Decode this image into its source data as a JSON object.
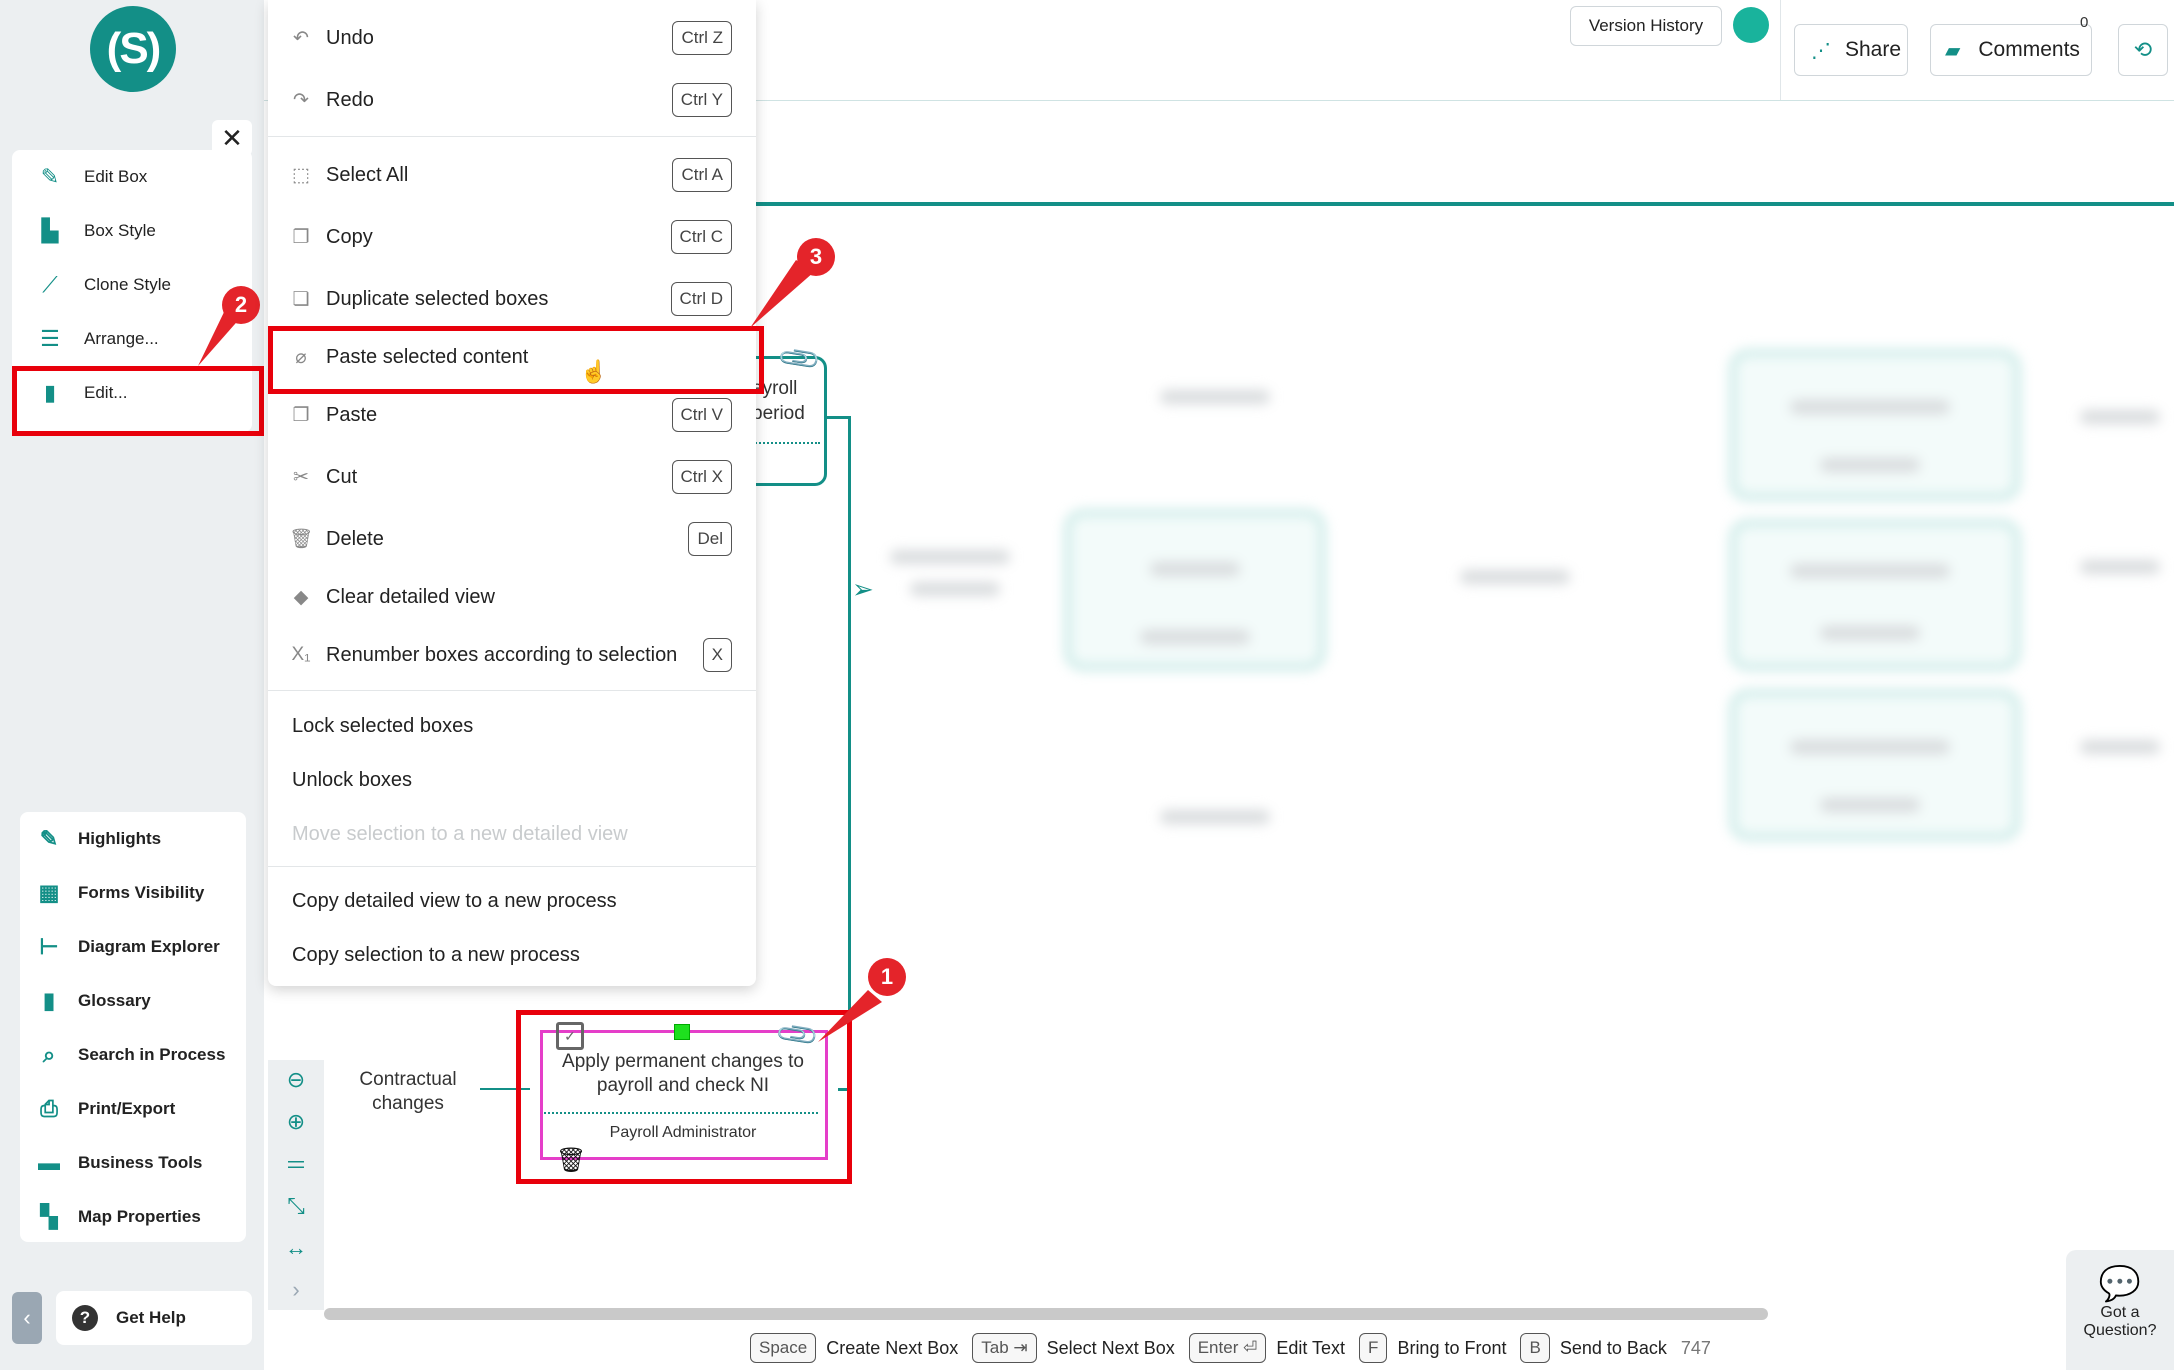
{
  "logo": {
    "text": "(S)"
  },
  "edit_panel": {
    "items": [
      {
        "label": "Edit Box",
        "icon": "pencil-icon"
      },
      {
        "label": "Box Style",
        "icon": "palette-icon"
      },
      {
        "label": "Clone Style",
        "icon": "eyedropper-icon"
      },
      {
        "label": "Arrange...",
        "icon": "align-icon"
      },
      {
        "label": "Edit...",
        "icon": "clipboard-icon"
      }
    ]
  },
  "tools_panel": {
    "items": [
      {
        "label": "Highlights",
        "icon": "highlighter-icon"
      },
      {
        "label": "Forms Visibility",
        "icon": "table-icon"
      },
      {
        "label": "Diagram Explorer",
        "icon": "tree-icon"
      },
      {
        "label": "Glossary",
        "icon": "book-icon"
      },
      {
        "label": "Search in Process",
        "icon": "search-icon"
      },
      {
        "label": "Print/Export",
        "icon": "printer-icon"
      },
      {
        "label": "Business Tools",
        "icon": "briefcase-icon"
      },
      {
        "label": "Map Properties",
        "icon": "map-icon"
      }
    ]
  },
  "help": {
    "label": "Get Help"
  },
  "topbar": {
    "version_history": "Version History",
    "share": "Share",
    "comments": "Comments",
    "comments_count": "0"
  },
  "context_menu": {
    "items": [
      {
        "label": "Undo",
        "shortcut": "Ctrl Z"
      },
      {
        "label": "Redo",
        "shortcut": "Ctrl Y"
      },
      {
        "label": "Select All",
        "shortcut": "Ctrl A"
      },
      {
        "label": "Copy",
        "shortcut": "Ctrl C"
      },
      {
        "label": "Duplicate selected boxes",
        "shortcut": "Ctrl D"
      },
      {
        "label": "Paste selected content",
        "shortcut": ""
      },
      {
        "label": "Paste",
        "shortcut": "Ctrl V"
      },
      {
        "label": "Cut",
        "shortcut": "Ctrl X"
      },
      {
        "label": "Delete",
        "shortcut": "Del"
      },
      {
        "label": "Clear detailed view",
        "shortcut": ""
      },
      {
        "label": "Renumber boxes according to selection",
        "shortcut": "X"
      },
      {
        "label": "Lock selected boxes"
      },
      {
        "label": "Unlock boxes"
      },
      {
        "label": "Move selection to a new detailed view",
        "disabled": true
      },
      {
        "label": "Copy detailed view to a new process"
      },
      {
        "label": "Copy selection to a new process"
      }
    ]
  },
  "diagram": {
    "top_box_text_line1": "ayroll",
    "top_box_text_line2": "period",
    "input_label_line1": "Contractual",
    "input_label_line2": "changes",
    "selected_box_line1": "Apply permanent changes to",
    "selected_box_line2": "payroll and check NI",
    "selected_box_role": "Payroll Administrator"
  },
  "annotations": {
    "badge1": "1",
    "badge2": "2",
    "badge3": "3"
  },
  "status_bar": {
    "items": [
      {
        "key": "Space",
        "label": "Create Next Box"
      },
      {
        "key": "Tab ⇥",
        "label": "Select Next Box"
      },
      {
        "key": "Enter ⏎",
        "label": "Edit Text"
      },
      {
        "key": "F",
        "label": "Bring to Front"
      },
      {
        "key": "B",
        "label": "Send to Back"
      }
    ],
    "zoom_value": "747"
  },
  "chat_widget": {
    "label_line1": "Got a",
    "label_line2": "Question?"
  },
  "colors": {
    "brand": "#138f87",
    "highlight_red": "#e8000b",
    "selection_magenta": "#e53ec9"
  }
}
